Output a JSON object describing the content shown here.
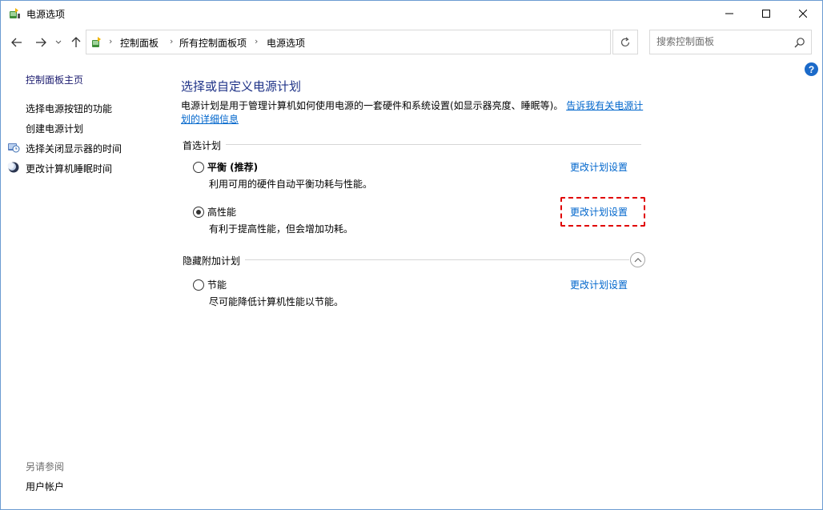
{
  "window": {
    "title": "电源选项"
  },
  "nav": {
    "back_icon": "arrow-left-icon",
    "forward_icon": "arrow-right-icon",
    "recent_icon": "chevron-down-icon",
    "up_icon": "arrow-up-icon",
    "breadcrumb": [
      "控制面板",
      "所有控制面板项",
      "电源选项"
    ],
    "search_placeholder": "搜索控制面板"
  },
  "sidebar": {
    "home": "控制面板主页",
    "items": [
      {
        "label": "选择电源按钮的功能",
        "icon": ""
      },
      {
        "label": "创建电源计划",
        "icon": ""
      },
      {
        "label": "选择关闭显示器的时间",
        "icon": "clock-display-icon"
      },
      {
        "label": "更改计算机睡眠时间",
        "icon": "moon-icon"
      }
    ],
    "see_also_label": "另请参阅",
    "see_also_items": [
      "用户帐户"
    ]
  },
  "main": {
    "title": "选择或自定义电源计划",
    "description": "电源计划是用于管理计算机如何使用电源的一套硬件和系统设置(如显示器亮度、睡眠等)。",
    "learn_more_link": "告诉我有关电源计划的详细信息",
    "preferred_section": "首选计划",
    "hidden_section": "隐藏附加计划",
    "plans": [
      {
        "name": "平衡 (推荐)",
        "desc": "利用可用的硬件自动平衡功耗与性能。",
        "selected": false,
        "link": "更改计划设置"
      },
      {
        "name": "高性能",
        "desc": "有利于提高性能，但会增加功耗。",
        "selected": true,
        "link": "更改计划设置"
      },
      {
        "name": "节能",
        "desc": "尽可能降低计算机性能以节能。",
        "selected": false,
        "link": "更改计划设置"
      }
    ]
  },
  "colors": {
    "title_blue": "#1e3287",
    "link_blue": "#0066cc",
    "highlight_red": "#e00000",
    "help_blue": "#1b6ac9"
  }
}
